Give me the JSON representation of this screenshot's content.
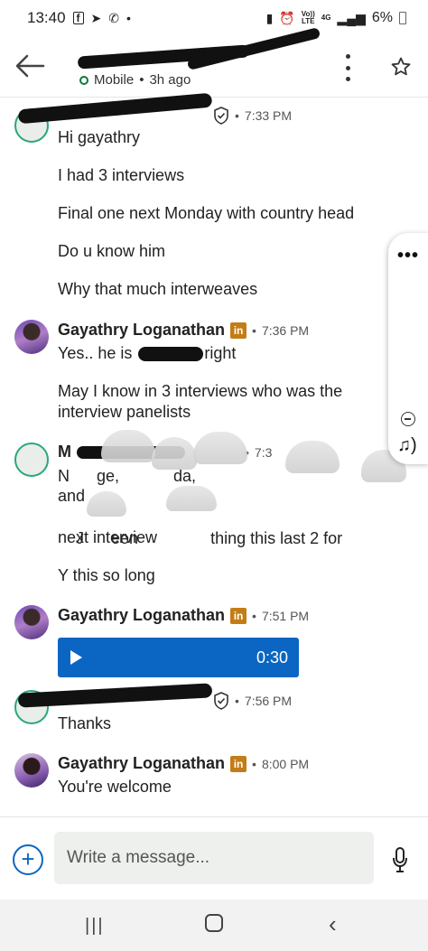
{
  "status_bar": {
    "time": "13:40",
    "battery": "6%",
    "network": "4G",
    "network_sub": "LTE",
    "volte": "Vo))",
    "icons": [
      "facebook-icon",
      "telegram-icon",
      "whatsapp-icon",
      "dot-icon",
      "battery-saver-icon",
      "alarm-icon",
      "signal-icon",
      "battery-icon"
    ]
  },
  "header": {
    "presence": "Mobile",
    "last_seen": "3h ago"
  },
  "messages": [
    {
      "sender": "",
      "time": "7:33 PM",
      "lines": [
        "Hi gayathry",
        "I had 3 interviews",
        "Final one next Monday with country head",
        "Do u know him",
        "Why that much interweaves"
      ]
    },
    {
      "sender": "Gayathry Loganathan",
      "time": "7:36 PM",
      "line1_start": "Yes.. he is",
      "line1_end": "right",
      "line2": "May I know in 3 interviews who was the interview panelists"
    },
    {
      "sender": "M",
      "time": "7:3",
      "line1": "N      ge,            da,",
      "line2": "and",
      "line3_start": "J",
      "line3_mid": "een",
      "line3_end": "thing this last 2 for",
      "line4": "next interview",
      "line5": "Y this so long"
    },
    {
      "sender": "Gayathry Loganathan",
      "time": "7:51 PM",
      "audio_duration": "0:30"
    },
    {
      "sender": "",
      "time": "7:56 PM",
      "text": "Thanks"
    },
    {
      "sender": "Gayathry Loganathan",
      "time": "8:00 PM",
      "text": "You're welcome"
    }
  ],
  "linkedin_badge": "in",
  "composer": {
    "placeholder": "Write a message..."
  },
  "colors": {
    "accent_blue": "#0a66c2",
    "presence_green": "#0a7a3a",
    "linkedin_badge": "#c37d16"
  }
}
